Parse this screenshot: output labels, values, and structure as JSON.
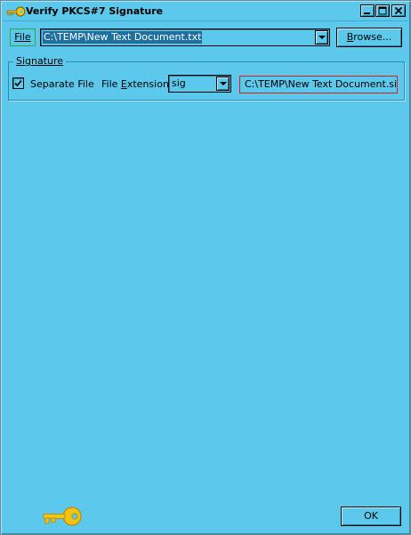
{
  "window": {
    "title": "Verify PKCS#7 Signature",
    "icons": {
      "app": "key-icon",
      "minimize": "minimize-icon",
      "maximize": "maximize-icon",
      "close": "close-icon"
    }
  },
  "file_row": {
    "file_button": {
      "prefix": "",
      "underlined": "F",
      "suffix": "ile"
    },
    "file_path": "C:\\TEMP\\New Text Document.txt",
    "browse_button": {
      "prefix": "",
      "underlined": "B",
      "suffix": "rowse..."
    }
  },
  "signature_group": {
    "label": {
      "prefix": "",
      "underlined": "S",
      "suffix": "ignature"
    },
    "separate_file": {
      "checked": true,
      "label": "Separate File"
    },
    "file_extension_label": {
      "prefix": "File ",
      "underlined": "E",
      "suffix": "xtension"
    },
    "file_extension_value": "sig",
    "signature_file_path": "C:\\TEMP\\New Text Document.sig"
  },
  "footer": {
    "ok_button": "OK",
    "decoration_icon": "key-icon"
  },
  "colors": {
    "background": "#5BC8EC",
    "selection": "#1f6f9f",
    "file_button_border": "#2ea84a",
    "error_border": "#d02020",
    "key": "#f2c416"
  }
}
